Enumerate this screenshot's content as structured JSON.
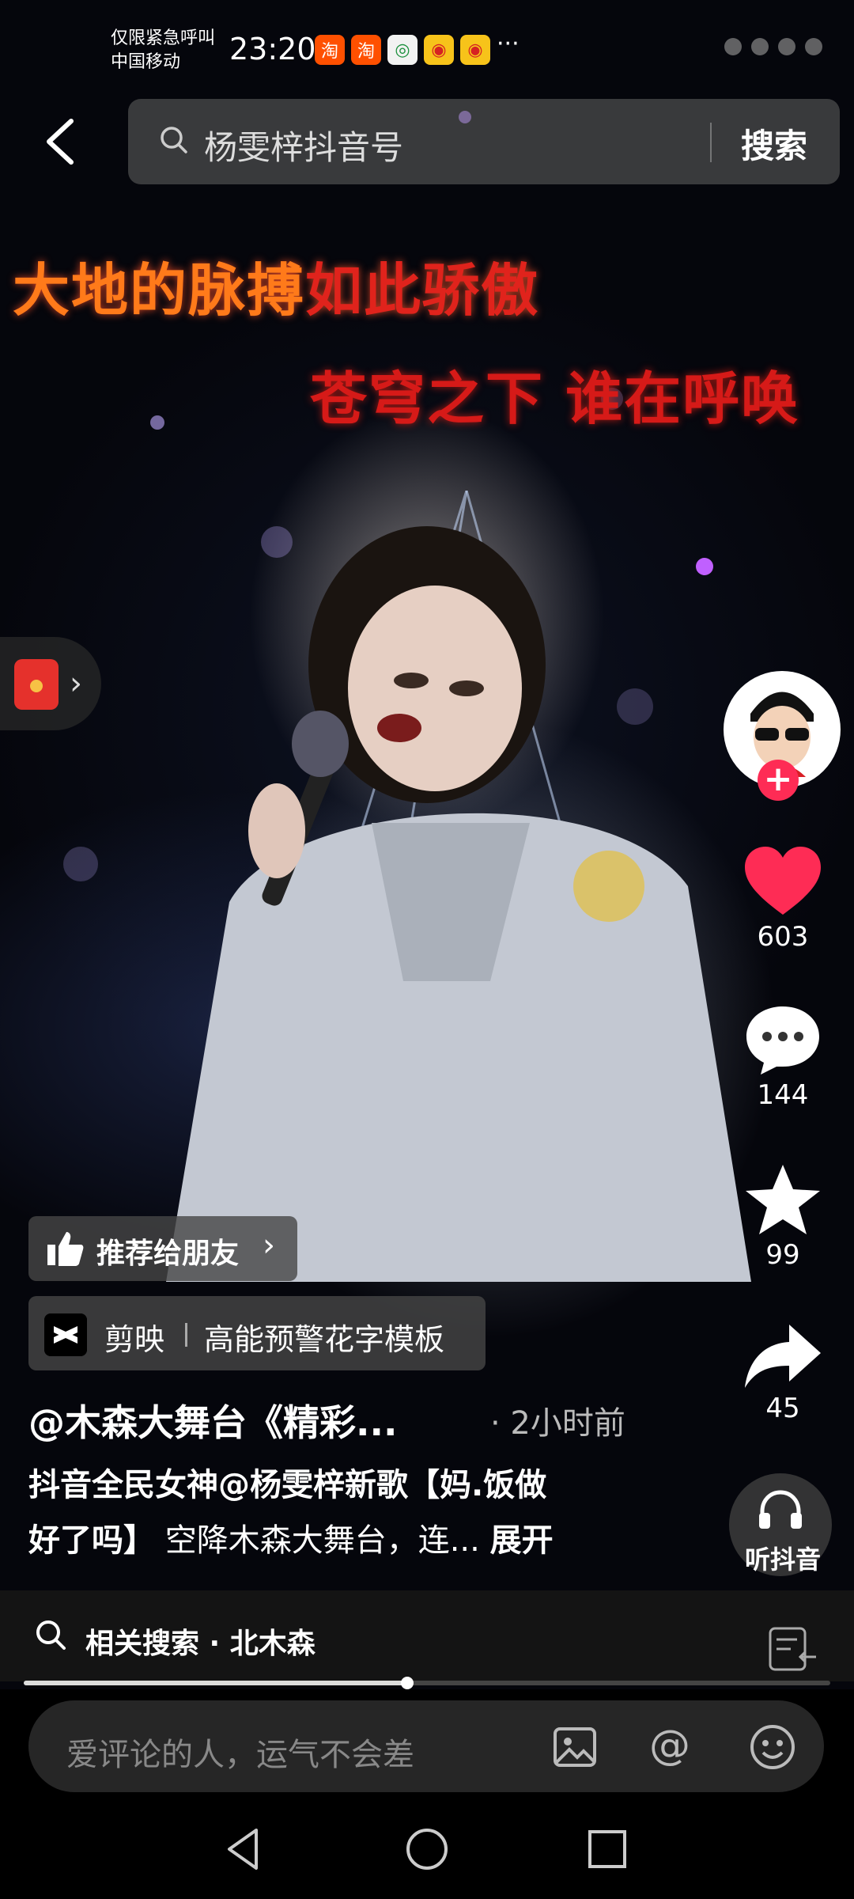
{
  "status_bar": {
    "emergency": "仅限紧急呼叫",
    "carrier": "中国移动",
    "time": "23:20",
    "more": "···"
  },
  "search": {
    "query": "杨雯梓抖音号",
    "button": "搜索"
  },
  "video": {
    "lyric_line1_part1": "大地的脉搏",
    "lyric_line1_part2": "如此骄傲",
    "lyric_line2": "苍穹之下  谁在呼唤"
  },
  "actions": {
    "likes": "603",
    "comments": "144",
    "favorites": "99",
    "shares": "45",
    "listen_label": "听抖音"
  },
  "recommend": {
    "label": "推荐给朋友"
  },
  "capcut": {
    "app": "剪映",
    "template": "高能预警花字模板"
  },
  "post": {
    "author": "@木森大舞台《精彩...",
    "time_ago": "· 2小时前",
    "desc_line1": "抖音全民女神@杨雯梓新歌【妈.饭做",
    "desc_line2_bold": "好了吗】",
    "desc_line2_rest": " 空降木森大舞台，连...",
    "expand": "展开"
  },
  "related": {
    "label": "相关搜索 · 北木森"
  },
  "progress": {
    "fraction": 0.475
  },
  "comment": {
    "placeholder": "爱评论的人，运气不会差"
  },
  "colors": {
    "like_red": "#fe2c55",
    "lyric_orange": "#ff7a1a",
    "lyric_red": "#d61a18"
  }
}
